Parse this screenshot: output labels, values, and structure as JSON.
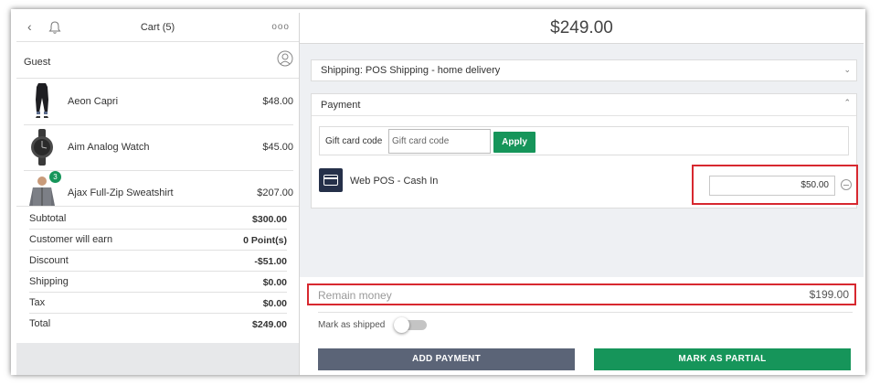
{
  "header": {
    "cart_title": "Cart (5)",
    "back_icon": "chevron-left-icon",
    "bell_icon": "bell-icon",
    "more_icon": "more-dots-icon",
    "dots": "ooo"
  },
  "customer": {
    "label": "Guest",
    "icon": "user-icon"
  },
  "items": [
    {
      "name": "Aeon Capri",
      "price": "$48.00",
      "qty": ""
    },
    {
      "name": "Aim Analog Watch",
      "price": "$45.00",
      "qty": ""
    },
    {
      "name": "Ajax Full-Zip Sweatshirt",
      "price": "$207.00",
      "qty": "3"
    }
  ],
  "totals": [
    {
      "label": "Subtotal",
      "value": "$300.00"
    },
    {
      "label": "Customer will earn",
      "value": "0 Point(s)"
    },
    {
      "label": "Discount",
      "value": "-$51.00"
    },
    {
      "label": "Shipping",
      "value": "$0.00"
    },
    {
      "label": "Tax",
      "value": "$0.00"
    },
    {
      "label": "Total",
      "value": "$249.00"
    }
  ],
  "checkout": {
    "grand_total": "$249.00",
    "shipping_label": "Shipping: POS Shipping - home delivery",
    "payment_label": "Payment",
    "gift_label": "Gift card code",
    "gift_placeholder": "Gift card code",
    "apply_label": "Apply",
    "method_name": "Web POS - Cash In",
    "method_amount": "$50.00",
    "remain_label": "Remain money",
    "remain_value": "$199.00",
    "mark_shipped_label": "Mark as shipped",
    "mark_shipped_on": false,
    "add_payment_label": "ADD PAYMENT",
    "mark_partial_label": "MARK AS PARTIAL"
  },
  "colors": {
    "accent_green": "#16955a",
    "button_gray": "#5b6477",
    "highlight_red": "#d7282f",
    "method_icon_bg": "#253049"
  }
}
